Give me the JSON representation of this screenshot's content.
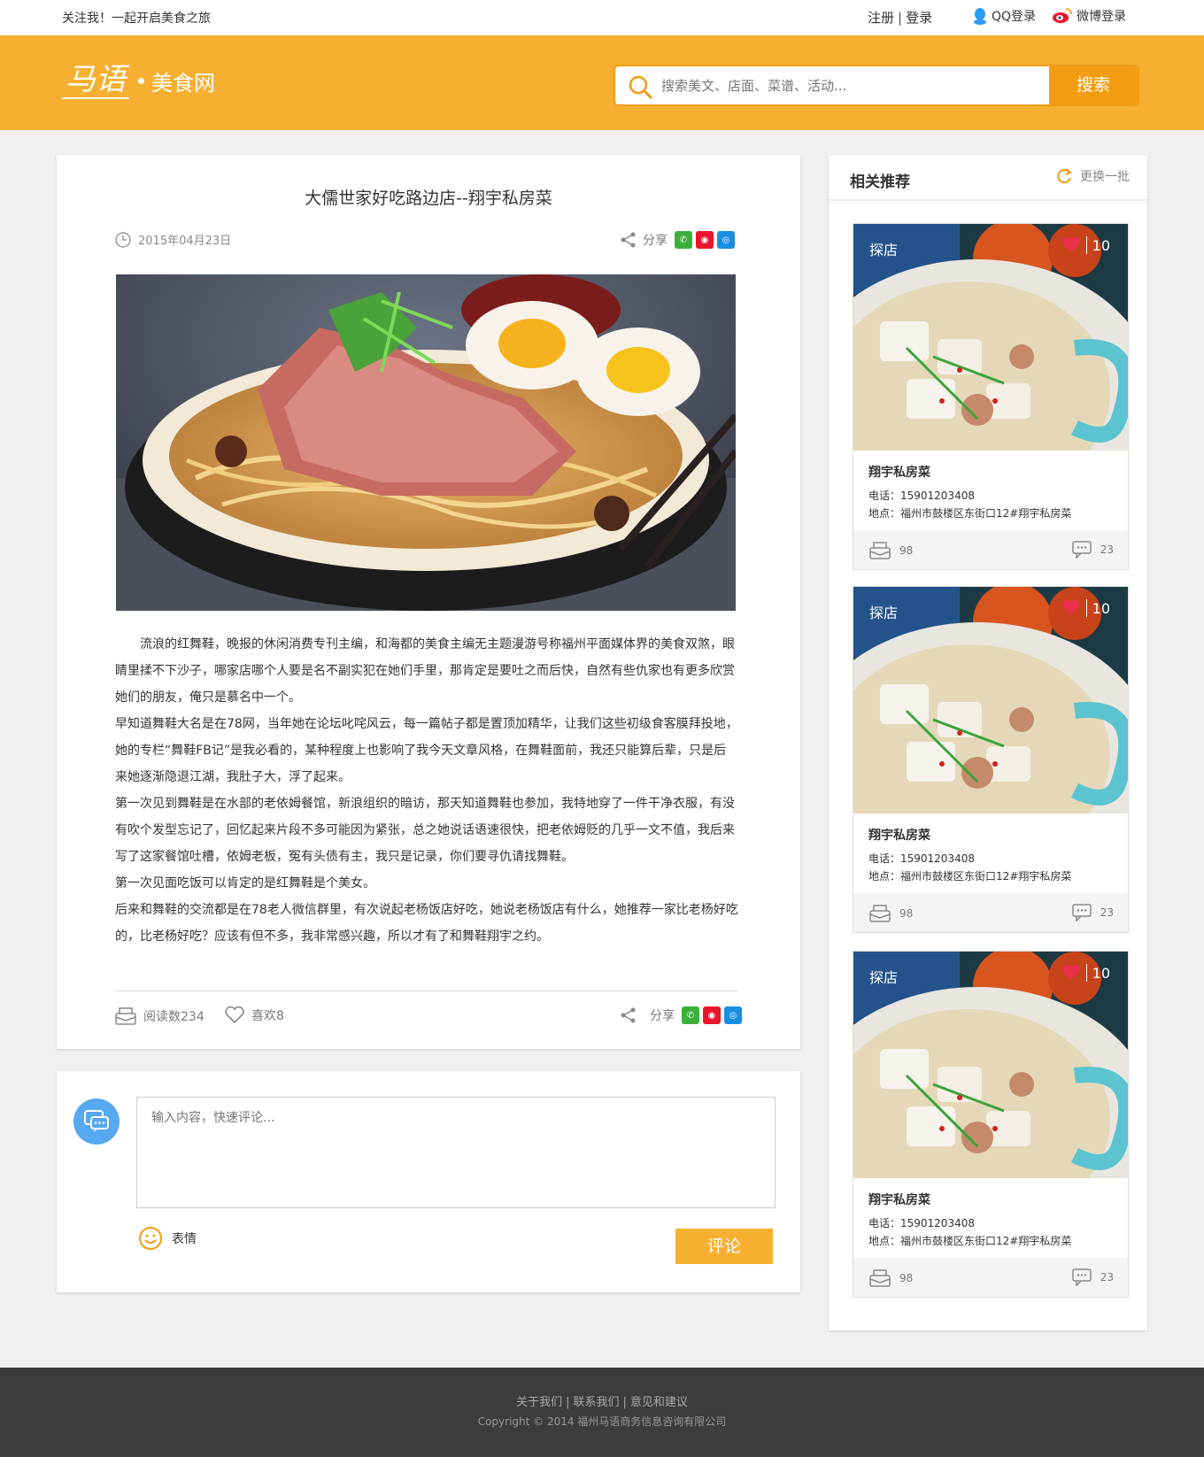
{
  "topbar": {
    "tagline": "关注我！一起开启美食之旅",
    "register": "注册",
    "divider": "|",
    "login": "登录",
    "qq_login": "QQ登录",
    "weibo_login": "微博登录"
  },
  "header": {
    "logo_mark": "马语",
    "site_name": "美食网",
    "search_placeholder": "搜索美文、店面、菜谱、活动...",
    "search_button": "搜索"
  },
  "article": {
    "title": "大儒世家好吃路边店--翔宇私房菜",
    "date": "2015年04月23日",
    "share_label": "分享",
    "paragraphs": [
      "流浪的红舞鞋，晚报的休闲消费专刊主编，和海都的美食主编无主题漫游号称福州平面媒体界的美食双煞，眼睛里揉不下沙子，哪家店哪个人要是名不副实犯在她们手里，那肯定是要吐之而后快，自然有些仇家也有更多欣赏她们的朋友，俺只是慕名中一个。",
      "早知道舞鞋大名是在78网，当年她在论坛叱咤风云，每一篇帖子都是置顶加精华，让我们这些初级食客膜拜投地，她的专栏“舞鞋FB记”是我必看的，某种程度上也影响了我今天文章风格，在舞鞋面前，我还只能算后辈，只是后来她逐渐隐退江湖，我肚子大，浮了起来。",
      "第一次见到舞鞋是在水部的老依姆餐馆，新浪组织的暗访，那天知道舞鞋也参加，我特地穿了一件干净衣服，有没有吹个发型忘记了，回忆起来片段不多可能因为紧张，总之她说话语速很快，把老依姆贬的几乎一文不值，我后来写了这家餐馆吐槽，依姆老板，冤有头债有主，我只是记录，你们要寻仇请找舞鞋。",
      "第一次见面吃饭可以肯定的是红舞鞋是个美女。",
      "后来和舞鞋的交流都是在78老人微信群里，有次说起老杨饭店好吃，她说老杨饭店有什么，她推荐一家比老杨好吃的，比老杨好吃？应该有但不多，我非常感兴趣，所以才有了和舞鞋翔宇之约。"
    ],
    "reads": "阅读数234",
    "likes": "喜欢8"
  },
  "comment": {
    "placeholder": "输入内容，快速评论...",
    "emoji_label": "表情",
    "submit": "评论"
  },
  "sidebar": {
    "title": "相关推荐",
    "refresh": "更换一批",
    "items": [
      {
        "tag": "探店",
        "favorites": "10",
        "name": "翔宇私房菜",
        "phone": "电话：15901203408",
        "address": "地点：福州市鼓楼区东街口12#翔宇私房菜",
        "views": "98",
        "comments": "23"
      },
      {
        "tag": "探店",
        "favorites": "10",
        "name": "翔宇私房菜",
        "phone": "电话：15901203408",
        "address": "地点：福州市鼓楼区东街口12#翔宇私房菜",
        "views": "98",
        "comments": "23"
      },
      {
        "tag": "探店",
        "favorites": "10",
        "name": "翔宇私房菜",
        "phone": "电话：15901203408",
        "address": "地点：福州市鼓楼区东街口12#翔宇私房菜",
        "views": "98",
        "comments": "23"
      }
    ]
  },
  "footer": {
    "about": "关于我们",
    "contact": "联系我们",
    "feedback": "意见和建议",
    "sep": "|",
    "copyright": "Copyright © 2014 福州马语商务信息咨询有限公司"
  },
  "colors": {
    "brand": "#f6af30",
    "button": "#f39c12",
    "avatar": "#56a8f0",
    "footer": "#3c3c3c"
  },
  "icons": [
    "qq-icon",
    "weibo-icon",
    "search-icon",
    "clock-icon",
    "share-icon",
    "wechat-icon",
    "sina-icon",
    "tencent-icon",
    "reads-icon",
    "heart-icon",
    "chat-avatar-icon",
    "smiley-icon",
    "refresh-icon",
    "favorite-heart-icon",
    "comment-icon"
  ]
}
